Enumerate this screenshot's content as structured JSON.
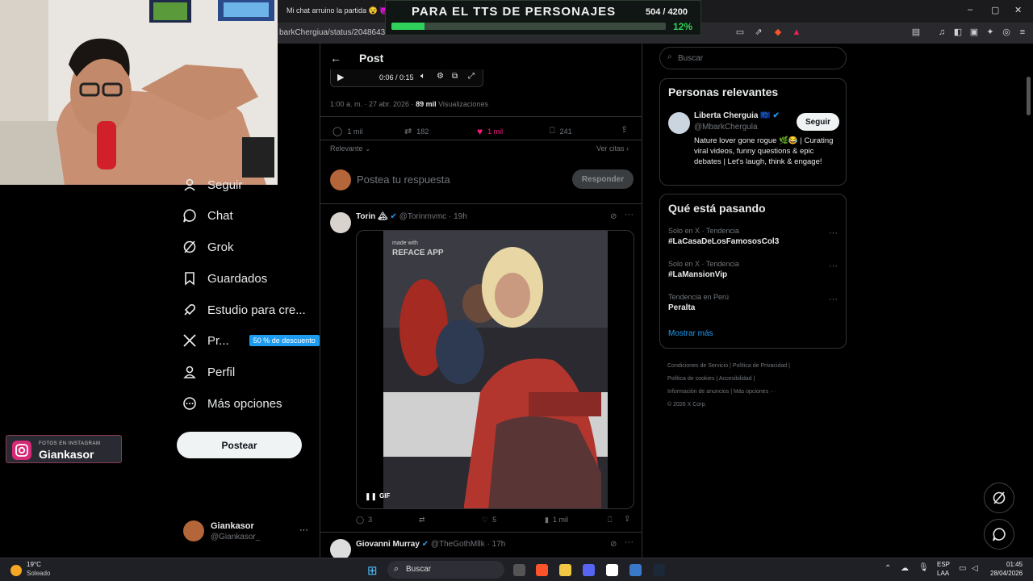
{
  "browser": {
    "tab_title": "Mi chat arruino la partida 😵 😈 | L",
    "url": "barkChergiua/status/20486433055",
    "window_controls": [
      "–",
      "▢",
      "✕"
    ]
  },
  "tts_overlay": {
    "title": "PARA EL TTS DE PERSONAJES",
    "count": "504 / 4200",
    "percent": "12%",
    "progress": 0.12
  },
  "instagram_overlay": {
    "small_label": "FOTOS EN INSTAGRAM",
    "name": "Giankasor"
  },
  "left_nav": {
    "items": [
      {
        "label": "Seguir",
        "icon": "user-plus-icon"
      },
      {
        "label": "Chat",
        "icon": "chat-bubble-icon"
      },
      {
        "label": "Grok",
        "icon": "grok-icon"
      },
      {
        "label": "Guardados",
        "icon": "bookmark-icon"
      },
      {
        "label": "Estudio para cre...",
        "icon": "rocket-icon"
      },
      {
        "label": "Pr...",
        "icon": "x-logo-icon",
        "badge": "50 % de descuento"
      },
      {
        "label": "Perfil",
        "icon": "person-icon"
      },
      {
        "label": "Más opciones",
        "icon": "more-circle-icon"
      }
    ],
    "post_button": "Postear",
    "account": {
      "name": "Giankasor",
      "handle": "@Giankasor_",
      "more": "···"
    }
  },
  "center": {
    "header_title": "Post",
    "video": {
      "time": "0:06 / 0:15"
    },
    "meta": {
      "time_date": "1:00 a. m. · 27 abr. 2026 · ",
      "views_count": "89 mil",
      "views_label": " Visualizaciones"
    },
    "actions": {
      "replies": "1 mil",
      "reposts": "182",
      "likes": "1 mil",
      "bookmarks": "241"
    },
    "sort_label": "Relevante",
    "quotes_link": "Ver citas",
    "reply_placeholder": "Postea tu respuesta",
    "reply_button": "Responder",
    "tweet": {
      "name": "Torin 🏔",
      "handle": "@Torinmvmc",
      "time": "· 19h",
      "media_watermark_small": "made with",
      "media_watermark": "REFACE APP",
      "gif_label": "GIF",
      "actions": {
        "replies": "3",
        "reposts": "",
        "likes": "5",
        "views": "1 mil"
      }
    },
    "next_tweet": {
      "name": "Giovanni Murray",
      "handle": "@TheGothMllk",
      "time": "· 17h"
    }
  },
  "right": {
    "search_placeholder": "Buscar",
    "relevant": {
      "title": "Personas relevantes",
      "name": "Liberta Cherguia 🇪🇺",
      "handle": "@MbarkChergula",
      "follow": "Seguir",
      "bio": "Nature lover gone rogue 🌿😂 | Curating viral videos, funny questions & epic debates | Let's laugh, think & engage!"
    },
    "trends": {
      "title": "Qué está pasando",
      "items": [
        {
          "context": "Solo en X · Tendencia",
          "name": "#LaCasaDeLosFamososCol3"
        },
        {
          "context": "Solo en X · Tendencia",
          "name": "#LaMansionVip"
        },
        {
          "context": "Tendencia en Perú",
          "name": "Peralta"
        }
      ],
      "show_more": "Mostrar más"
    },
    "footer": {
      "links": [
        "Condiciones de Servicio",
        "Política de Privacidad",
        "Política de cookies",
        "Accesibilidad",
        "Información de anuncios",
        "Más opciones ···"
      ],
      "copyright": "© 2026 X Corp."
    }
  },
  "taskbar": {
    "weather_temp": "19°C",
    "weather_desc": "Soleado",
    "search_label": "Buscar",
    "lang_line1": "ESP",
    "lang_line2": "LAA",
    "time": "01:45",
    "date": "28/04/2026"
  },
  "colors": {
    "like": "#f91880",
    "link": "#1d9bf0",
    "progress": "#2fd15a"
  }
}
